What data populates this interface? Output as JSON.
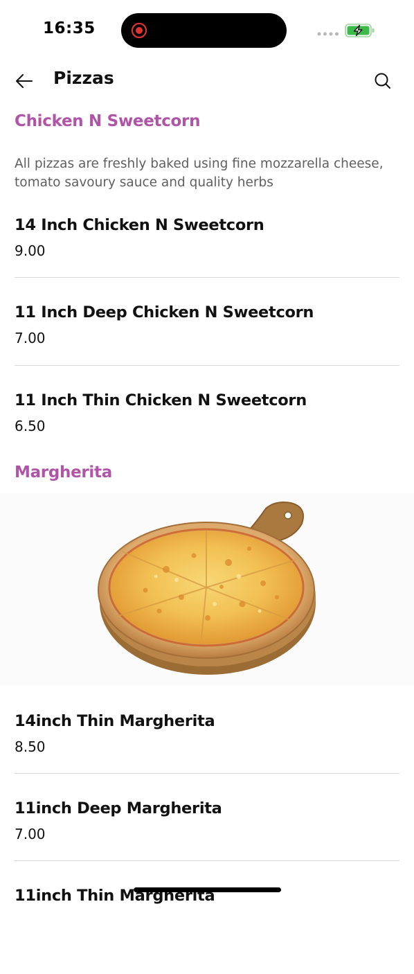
{
  "status_bar": {
    "time": "16:35"
  },
  "header": {
    "title": "Pizzas",
    "back_icon": "arrow-left-icon",
    "search_icon": "search-icon"
  },
  "sections": [
    {
      "title": "Chicken N Sweetcorn",
      "description": "All pizzas are freshly baked using fine mozzarella cheese, tomato savoury sauce and quality herbs",
      "items": [
        {
          "name": "14 Inch Chicken N Sweetcorn",
          "price": "9.00"
        },
        {
          "name": "11 Inch Deep Chicken N Sweetcorn",
          "price": "7.00"
        },
        {
          "name": "11 Inch Thin Chicken N Sweetcorn",
          "price": "6.50"
        }
      ]
    },
    {
      "title": "Margherita",
      "image": "margherita-pizza-on-wooden-board",
      "items": [
        {
          "name": "14inch Thin Margherita",
          "price": "8.50"
        },
        {
          "name": "11inch Deep Margherita",
          "price": "7.00"
        },
        {
          "name": "11inch Thin Margherita",
          "price": ""
        }
      ]
    }
  ],
  "colors": {
    "accent": "#b054a8",
    "divider": "#d7d7d7",
    "description": "#5f5f5f"
  }
}
